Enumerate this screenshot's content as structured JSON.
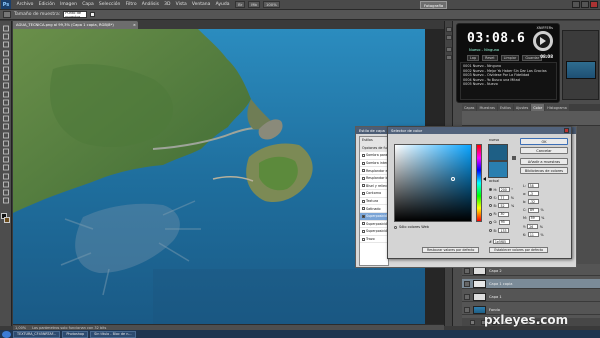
{
  "menubar": {
    "logo": "Ps",
    "items": [
      "Archivo",
      "Edición",
      "Imagen",
      "Capa",
      "Selección",
      "Filtro",
      "Análisis",
      "3D",
      "Vista",
      "Ventana",
      "Ayuda"
    ],
    "chip1": "Br",
    "chip2": "Mb",
    "zoom": "100%",
    "workspace": "Fotografía"
  },
  "options": {
    "sample_label": "Tamaño de muestra:",
    "sample_value": "Punto de muestra"
  },
  "document": {
    "tab_title": "AGUA_TECNICA.png al 99,3% (Capa 1 copia, RGB/8*)"
  },
  "status": {
    "zoom": "1,00%",
    "text": "Los parámetros solo funcionan con 32 bits"
  },
  "timer": {
    "brand": "XNIFFERs",
    "time": "03:08.6",
    "subtitle": "Nuevo - Ninguno",
    "clock": "08:08",
    "buttons": [
      "Lap",
      "Reset",
      "Limpiar",
      "Guardar"
    ],
    "rows": [
      "0001 Nuevo - Ninguno",
      "0002 Nuevo - Mejor Yo Haber Sin Dar Las Gracias",
      "0003 Nuevo - Olvídese Por La Fidelidad",
      "0004 Nuevo - Yo Busco una Mitad",
      "0005 Nuevo - Nuevo"
    ]
  },
  "panel_tabs": [
    "Capas",
    "Muestras",
    "Estilos",
    "Ajustes",
    "Color",
    "Histograma"
  ],
  "layers": {
    "rows": [
      {
        "name": "Capa 2",
        "selected": false
      },
      {
        "name": "Capa 1 copia",
        "selected": true
      },
      {
        "name": "Capa 1",
        "selected": false
      },
      {
        "name": "Fondo",
        "selected": false
      }
    ]
  },
  "style_dialog": {
    "title": "Estilo de capa",
    "rows": [
      {
        "label": "Estilos",
        "checked": false,
        "kind": "header"
      },
      {
        "label": "Opciones de fusión: Personalizadas",
        "checked": false,
        "kind": "header"
      },
      {
        "label": "Sombra paralela",
        "checked": false,
        "kind": "normal"
      },
      {
        "label": "Sombra interior",
        "checked": false,
        "kind": "normal"
      },
      {
        "label": "Resplandor exterior",
        "checked": false,
        "kind": "normal"
      },
      {
        "label": "Resplandor interior",
        "checked": false,
        "kind": "normal"
      },
      {
        "label": "Bisel y relieve",
        "checked": false,
        "kind": "normal"
      },
      {
        "label": "Contorno",
        "checked": false,
        "kind": "normal"
      },
      {
        "label": "Textura",
        "checked": false,
        "kind": "normal"
      },
      {
        "label": "Satinado",
        "checked": false,
        "kind": "normal"
      },
      {
        "label": "Superposición de colores",
        "checked": true,
        "kind": "selected"
      },
      {
        "label": "Superposición de degradado",
        "checked": false,
        "kind": "normal"
      },
      {
        "label": "Superposición de motivo",
        "checked": false,
        "kind": "normal"
      },
      {
        "label": "Trazo",
        "checked": false,
        "kind": "normal"
      }
    ]
  },
  "picker": {
    "title": "Selector de color",
    "new_label": "nuevo",
    "current_label": "actual",
    "ok": "OK",
    "cancel": "Cancelar",
    "add_swatches": "Añadir a muestras",
    "libraries": "Bibliotecas de colores",
    "only_web": "Sólo colores Web",
    "hex_label": "#",
    "hex_value": "1e5f85",
    "fields_left": [
      {
        "label": "H:",
        "value": "200",
        "unit": "°"
      },
      {
        "label": "S:",
        "value": "77",
        "unit": "%"
      },
      {
        "label": "B:",
        "value": "52",
        "unit": "%"
      },
      {
        "label": "R:",
        "value": "30",
        "unit": ""
      },
      {
        "label": "G:",
        "value": "95",
        "unit": ""
      },
      {
        "label": "B:",
        "value": "133",
        "unit": ""
      }
    ],
    "fields_right": [
      {
        "label": "L:",
        "value": "38",
        "unit": ""
      },
      {
        "label": "a:",
        "value": "-3",
        "unit": ""
      },
      {
        "label": "b:",
        "value": "-32",
        "unit": ""
      },
      {
        "label": "C:",
        "value": "89",
        "unit": "%"
      },
      {
        "label": "M:",
        "value": "59",
        "unit": "%"
      },
      {
        "label": "Y:",
        "value": "26",
        "unit": "%"
      },
      {
        "label": "K:",
        "value": "11",
        "unit": "%"
      }
    ],
    "restore_defaults": "Restaurar valores por defecto",
    "make_default": "Establecer valores por defecto"
  },
  "taskbar": {
    "items": [
      "TEXTURA_CF45NRTAF...",
      "Photoshop",
      "Sin título - Bloc de n..."
    ]
  },
  "watermark": "pxleyes.com"
}
